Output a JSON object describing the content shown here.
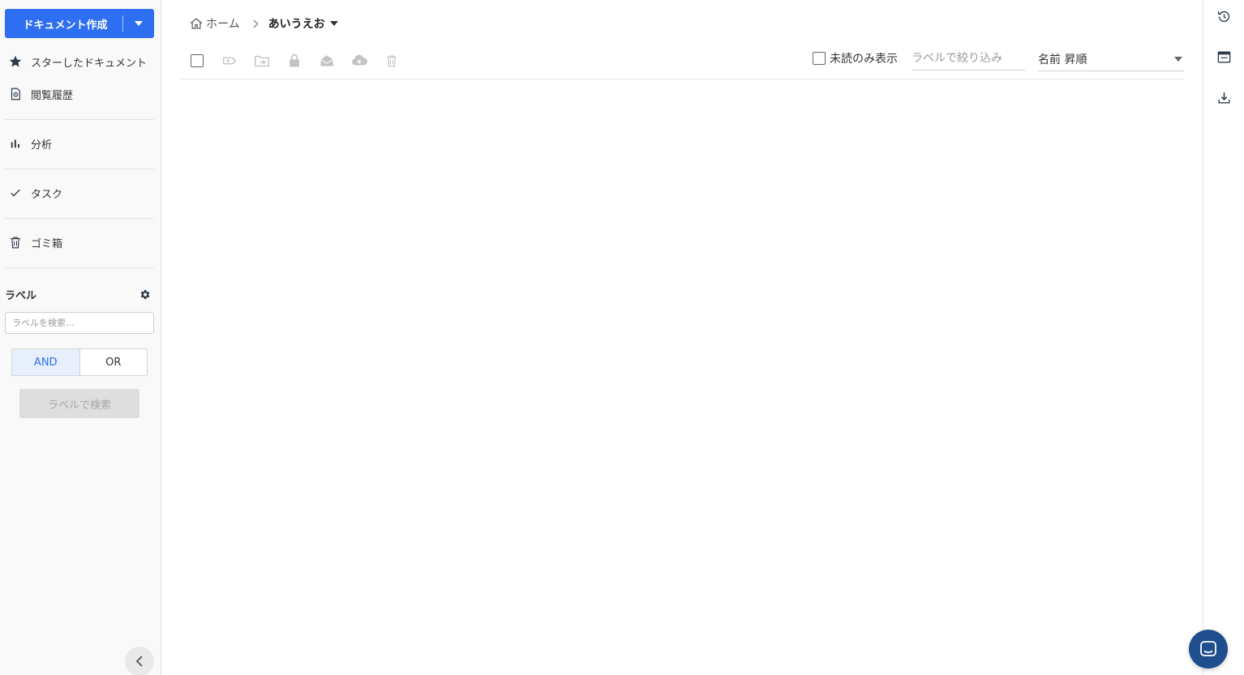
{
  "sidebar": {
    "create_button": {
      "label": "ドキュメント作成"
    },
    "items": [
      {
        "label": "スターしたドキュメント",
        "icon": "star-icon"
      },
      {
        "label": "閲覧履歴",
        "icon": "history-doc-icon"
      },
      {
        "label": "分析",
        "icon": "bar-chart-icon"
      },
      {
        "label": "タスク",
        "icon": "check-icon"
      },
      {
        "label": "ゴミ箱",
        "icon": "trash-icon"
      }
    ],
    "labels": {
      "title": "ラベル",
      "search_placeholder": "ラベルを検索...",
      "and_label": "AND",
      "or_label": "OR",
      "search_button": "ラベルで検索"
    }
  },
  "breadcrumb": {
    "home": "ホーム",
    "current": "あいうえお"
  },
  "toolbar": {
    "icons": [
      "select-all-checkbox",
      "add-label-icon",
      "move-folder-icon",
      "lock-icon",
      "mark-read-icon",
      "download-icon",
      "delete-icon"
    ],
    "unread_only_label": "未読のみ表示",
    "filter_placeholder": "ラベルで絞り込み",
    "sort_value": "名前 昇順"
  },
  "right_rail": {
    "icons": [
      "history-icon",
      "window-icon",
      "download-icon"
    ]
  },
  "colors": {
    "primary": "#2e6ff2",
    "chat_fab": "#1f4e8e",
    "sidebar_bg": "#f9f9f9"
  }
}
